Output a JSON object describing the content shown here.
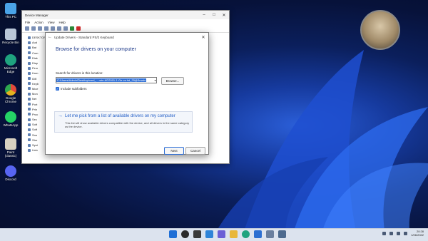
{
  "desktop": {
    "icons": [
      {
        "label": "This PC",
        "icon": "this-pc-icon",
        "color": "#4aa3e8"
      },
      {
        "label": "Recycle Bin",
        "icon": "recycle-bin-icon",
        "color": "#b9c6d8"
      },
      {
        "label": "Microsoft Edge",
        "icon": "edge-icon",
        "color": "#1fa37f"
      },
      {
        "label": "Google Chrome",
        "icon": "chrome-icon",
        "color": "#e3b21f"
      },
      {
        "label": "WhatsApp",
        "icon": "whatsapp-icon",
        "color": "#25d366"
      },
      {
        "label": "Paint (classic)",
        "icon": "paint-icon",
        "color": "#d8d2c2"
      },
      {
        "label": "Discord",
        "icon": "discord-icon",
        "color": "#5865f2"
      }
    ]
  },
  "device_manager": {
    "title": "Device Manager",
    "menu": [
      "File",
      "Action",
      "View",
      "Help"
    ],
    "tree_items": [
      "DESKTOP-",
      "Aud",
      "Bat",
      "Com",
      "Disk",
      "Disp",
      "Firm",
      "Hum",
      "IDE",
      "Keyb",
      "Mice",
      "Mon",
      "Net",
      "Port",
      "Prin",
      "Proc",
      "Sec",
      "Soft",
      "Soft",
      "Sou",
      "Stor",
      "Syst",
      "Univ"
    ]
  },
  "dialog": {
    "title": "Update Drivers - Standard PS/2 Keyboard",
    "heading": "Browse for drivers on your computer",
    "search_label": "Search for drivers in this location:",
    "path_value": "C:\\Users\\Admin\\Desktop\\vmd_...-win-AD2001-1-Ge.va.hd_25@3main",
    "browse_label": "Browse...",
    "include_subfolders_label": "Include subfolders",
    "option_title": "Let me pick from a list of available drivers on my computer",
    "option_desc": "This list will show available drivers compatible with the device, and all drivers in the same category as the device.",
    "next_label": "Next",
    "cancel_label": "Cancel"
  },
  "taskbar": {
    "apps": [
      {
        "icon": "start-icon",
        "color": "#1f6fd6"
      },
      {
        "icon": "search-icon",
        "color": "#2b2b2b"
      },
      {
        "icon": "task-view-icon",
        "color": "#3a3a3a"
      },
      {
        "icon": "widgets-icon",
        "color": "#2f84d8"
      },
      {
        "icon": "chat-icon",
        "color": "#6a5fd6"
      },
      {
        "icon": "file-explorer-icon",
        "color": "#e8b73a"
      },
      {
        "icon": "edge-icon",
        "color": "#1fa37f"
      },
      {
        "icon": "store-icon",
        "color": "#2c6fd1"
      },
      {
        "icon": "device-manager-icon",
        "color": "#6a7f9e"
      },
      {
        "icon": "app-icon",
        "color": "#4d6a8e"
      }
    ],
    "time": "20:28",
    "date": "1/06/2022"
  }
}
